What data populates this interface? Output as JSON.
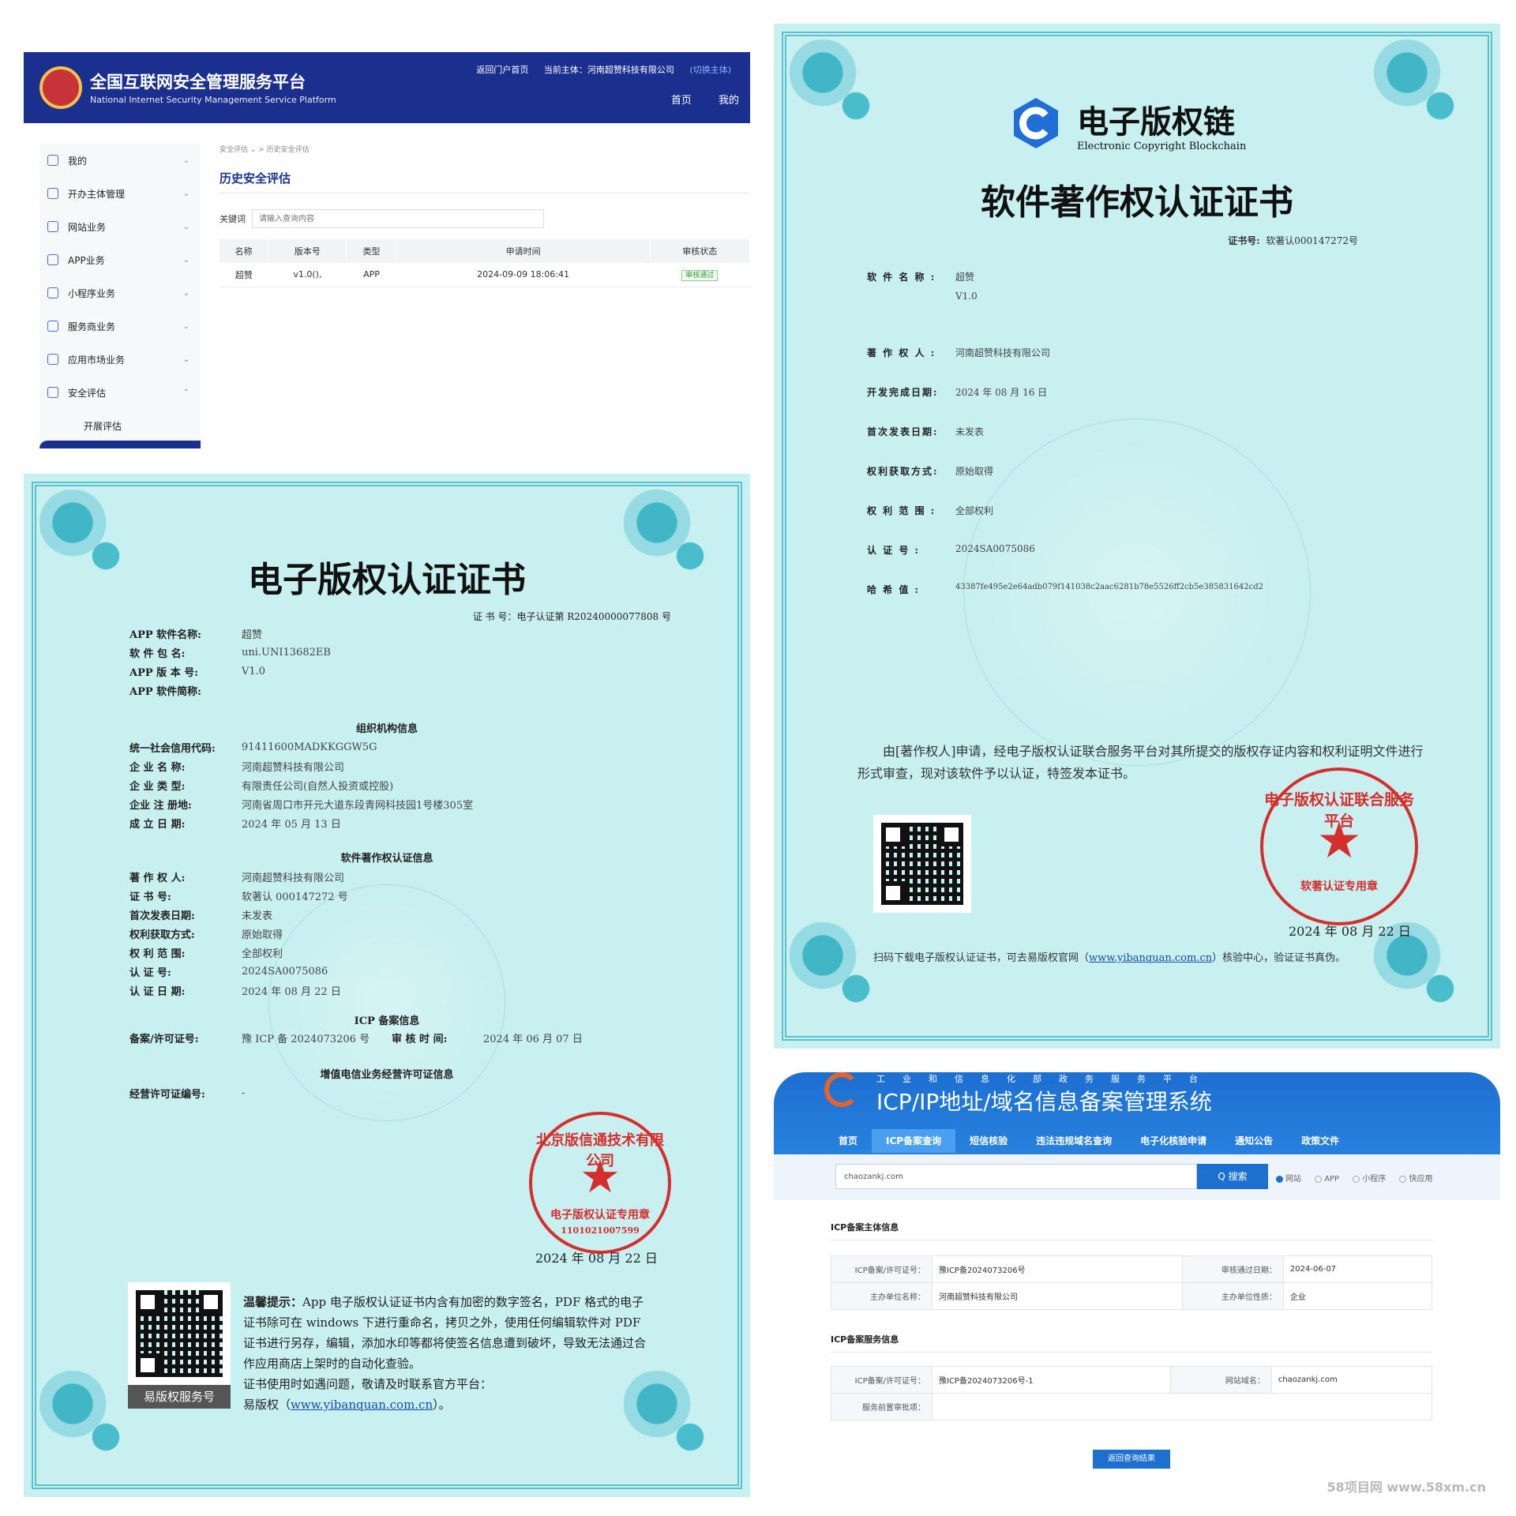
{
  "security_platform": {
    "title": "全国互联网安全管理服务平台",
    "subtitle": "National Internet Security Management Service Platform",
    "top_links": {
      "home_portal": "返回门户首页",
      "current_subject": "当前主体：河南超赞科技有限公司",
      "switch": "(切换主体)"
    },
    "nav": [
      "首页",
      "我的"
    ],
    "sidebar": [
      {
        "label": "我的",
        "arrow": "⌄"
      },
      {
        "label": "开办主体管理",
        "arrow": "⌄"
      },
      {
        "label": "网站业务",
        "arrow": "⌄"
      },
      {
        "label": "APP业务",
        "arrow": "⌄"
      },
      {
        "label": "小程序业务",
        "arrow": "⌄"
      },
      {
        "label": "服务商业务",
        "arrow": "⌄"
      },
      {
        "label": "应用市场业务",
        "arrow": "⌄"
      },
      {
        "label": "安全评估",
        "arrow": "⌃"
      }
    ],
    "sidebar_sub": "开展评估",
    "breadcrumb": "安全评估 ⌄  >  历史安全评估",
    "page_title": "历史安全评估",
    "keyword_label": "关键词",
    "keyword_placeholder": "请输入查询内容",
    "table": {
      "headers": [
        "名称",
        "版本号",
        "类型",
        "申请时间",
        "审核状态"
      ],
      "row": [
        "超赞",
        "v1.0(),",
        "APP",
        "2024-09-09 18:06:41"
      ],
      "status": "审核通过"
    }
  },
  "ecopyright_cert": {
    "title": "电子版权认证证书",
    "cert_no": "证 书 号：电子认证第 R20240000077808 号",
    "app_rows": [
      {
        "k": "APP 软件名称:",
        "v": "超赞"
      },
      {
        "k": "软 件 包 名:",
        "v": "uni.UNI13682EB"
      },
      {
        "k": "APP 版 本 号:",
        "v": "V1.0"
      },
      {
        "k": "APP 软件简称:",
        "v": ""
      }
    ],
    "org_title": "组织机构信息",
    "org_rows": [
      {
        "k": "统一社会信用代码:",
        "v": "91411600MADKKGGW5G"
      },
      {
        "k": "企 业 名 称:",
        "v": "河南超赞科技有限公司"
      },
      {
        "k": "企 业 类 型:",
        "v": "有限责任公司(自然人投资或控股)"
      },
      {
        "k": "企业 注 册地:",
        "v": "河南省周口市开元大道东段青网科技园1号楼305室"
      },
      {
        "k": "成 立 日 期:",
        "v": "2024 年 05 月 13 日"
      }
    ],
    "sw_title": "软件著作权认证信息",
    "sw_rows": [
      {
        "k": "著 作 权 人:",
        "v": "河南超赞科技有限公司"
      },
      {
        "k": "证 书 号:",
        "v": "软著认 000147272 号"
      },
      {
        "k": "首次发表日期:",
        "v": "未发表"
      },
      {
        "k": "权利获取方式:",
        "v": "原始取得"
      },
      {
        "k": "权 利 范 围:",
        "v": "全部权利"
      },
      {
        "k": "认 证 号:",
        "v": "2024SA0075086"
      },
      {
        "k": "认 证 日 期:",
        "v": "2024 年 08 月 22 日"
      }
    ],
    "icp_title": "ICP 备案信息",
    "icp_k": "备案/许可证号:",
    "icp_v": "豫 ICP 备 2024073206 号",
    "audit_k": "审 核 时 间:",
    "audit_v": "2024 年 06 月 07 日",
    "vas_title": "增值电信业务经营许可证信息",
    "vas_k": "经营许可证编号:",
    "vas_v": "-",
    "stamp_text": "北京版信通技术有限公司",
    "stamp_sub": "电子版权认证专用章",
    "stamp_num": "1101021007599",
    "date": "2024 年 08 月 22 日",
    "qr_caption": "易版权服务号",
    "tip_label": "温馨提示：",
    "tip_text": "App 电子版权认证证书内含有加密的数字签名，PDF 格式的电子证书除可在 windows 下进行重命名，拷贝之外，使用任何编辑软件对 PDF 证书进行另存，编辑，添加水印等都将使签名信息遭到破坏，导致无法通过合作应用商店上架时的自动化查验。",
    "tip_line2": "证书使用时如遇问题，敬请及时联系官方平台：",
    "tip_line3a": "易版权（",
    "tip_link": "www.yibanquan.com.cn",
    "tip_line3b": "）。"
  },
  "software_cert": {
    "brand": "电子版权链",
    "brand_en": "Electronic Copyright Blockchain",
    "title": "软件著作权认证证书",
    "cert_no_label": "证书号:",
    "cert_no": "软著认000147272号",
    "rows": [
      {
        "k": "软 件 名 称 :",
        "v": "超赞"
      },
      {
        "k": "",
        "v": "V1.0"
      },
      {
        "k": "著 作 权 人 :",
        "v": "河南超赞科技有限公司"
      },
      {
        "k": "开发完成日期:",
        "v": "2024 年 08 月 16 日"
      },
      {
        "k": "首次发表日期:",
        "v": "未发表"
      },
      {
        "k": "权利获取方式:",
        "v": "原始取得"
      },
      {
        "k": "权 利 范 围 :",
        "v": "全部权利"
      },
      {
        "k": "认 证 号 :",
        "v": "2024SA0075086"
      },
      {
        "k": "哈 希 值 :",
        "v": "43387fe495e2e64adb079f141038c2aac6281b78e5526ff2cb5e385831642cd2"
      }
    ],
    "para": "由[著作权人]申请，经电子版权认证联合服务平台对其所提交的版权存证内容和权利证明文件进行形式审查，现对该软件予以认证，特签发本证书。",
    "stamp_text": "电子版权认证联合服务平台",
    "stamp_sub": "软著认证专用章",
    "date": "2024 年 08 月 22 日",
    "foot_a": "扫码下载电子版权认证证书，可去易版权官网（",
    "foot_link": "www.yibanquan.com.cn",
    "foot_b": "）核验中心，验证证书真伪。"
  },
  "icp_system": {
    "org": "工业和信息化部政务服务平台",
    "title": "ICP/IP地址/域名信息备案管理系统",
    "nav": [
      "首页",
      "ICP备案查询",
      "短信核验",
      "违法违规域名查询",
      "电子化核验申请",
      "通知公告",
      "政策文件"
    ],
    "search_value": "chaozankj.com",
    "search_btn": "Q 搜索",
    "radios": [
      "网站",
      "APP",
      "小程序",
      "快应用"
    ],
    "sec1": "ICP备案主体信息",
    "t1": [
      [
        "ICP备案/许可证号：",
        "豫ICP备2024073206号",
        "审核通过日期：",
        "2024-06-07"
      ],
      [
        "主办单位名称：",
        "河南超赞科技有限公司",
        "主办单位性质：",
        "企业"
      ]
    ],
    "sec2": "ICP备案服务信息",
    "t2": [
      [
        "ICP备案/许可证号：",
        "豫ICP备2024073206号-1",
        "网站域名：",
        "chaozankj.com"
      ],
      [
        "服务前置审批项：",
        "",
        "",
        ""
      ]
    ],
    "back_btn": "返回查询结果"
  },
  "watermark": "58项目网 www.58xm.cn"
}
